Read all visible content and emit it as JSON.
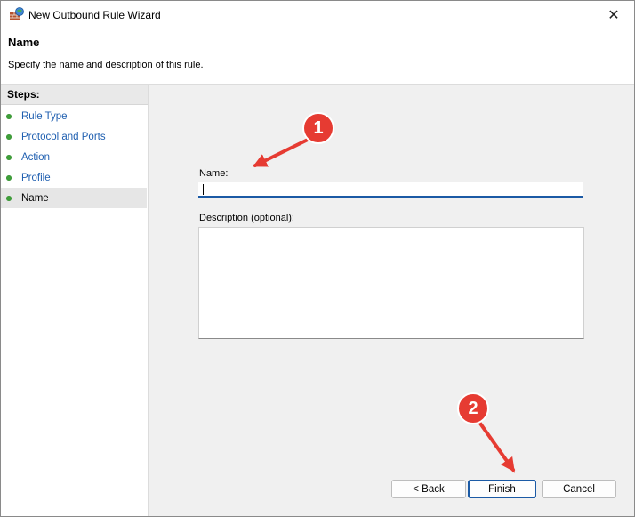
{
  "window": {
    "title": "New Outbound Rule Wizard",
    "close_glyph": "✕"
  },
  "header": {
    "title": "Name",
    "description": "Specify the name and description of this rule."
  },
  "steps": {
    "heading": "Steps:",
    "items": [
      {
        "label": "Rule Type"
      },
      {
        "label": "Protocol and Ports"
      },
      {
        "label": "Action"
      },
      {
        "label": "Profile"
      },
      {
        "label": "Name"
      }
    ]
  },
  "form": {
    "name_label": "Name:",
    "name_value": "",
    "description_label": "Description (optional):",
    "description_value": ""
  },
  "buttons": {
    "back": "< Back",
    "finish": "Finish",
    "cancel": "Cancel"
  },
  "annotations": {
    "badge1": "1",
    "badge2": "2",
    "color": "#e63b32"
  },
  "icons": {
    "title": "firewall-wizard-icon",
    "close": "close-icon",
    "step": "green-dot-icon"
  }
}
